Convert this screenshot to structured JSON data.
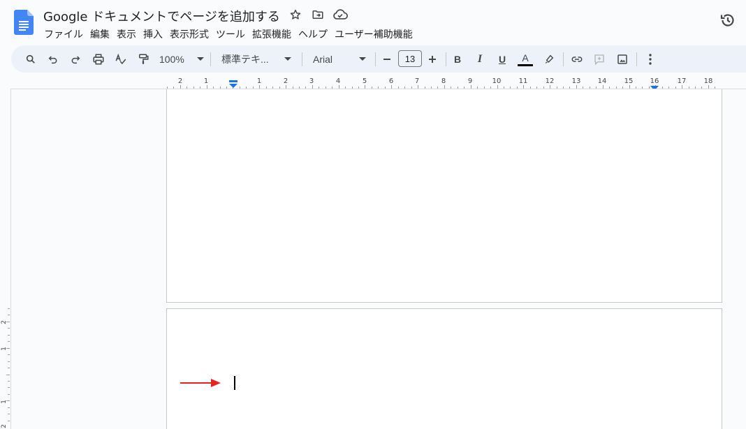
{
  "header": {
    "title": "Google ドキュメントでページを追加する",
    "icons": [
      "star-icon",
      "move-to-folder-icon",
      "cloud-saved-icon",
      "version-history-icon"
    ]
  },
  "menu": {
    "items": [
      "ファイル",
      "編集",
      "表示",
      "挿入",
      "表示形式",
      "ツール",
      "拡張機能",
      "ヘルプ",
      "ユーザー補助機能"
    ]
  },
  "toolbar": {
    "zoom": "100%",
    "style": "標準テキ...",
    "font": "Arial",
    "font_size": "13",
    "bold": "B",
    "italic": "I",
    "underline": "U",
    "text_color_letter": "A",
    "text_color": "#000000"
  },
  "ruler": {
    "labels": [
      "2",
      "1",
      "1",
      "2",
      "3",
      "4",
      "5",
      "6",
      "7",
      "8",
      "9",
      "10",
      "11",
      "12",
      "13",
      "14",
      "15",
      "16",
      "17",
      "18"
    ]
  },
  "vertical_ruler": {
    "labels": [
      "2",
      "1",
      "1",
      "2"
    ]
  },
  "colors": {
    "accent": "#1a73e8",
    "annotation_arrow": "#e8231f",
    "toolbar_bg": "#edf2fa"
  }
}
